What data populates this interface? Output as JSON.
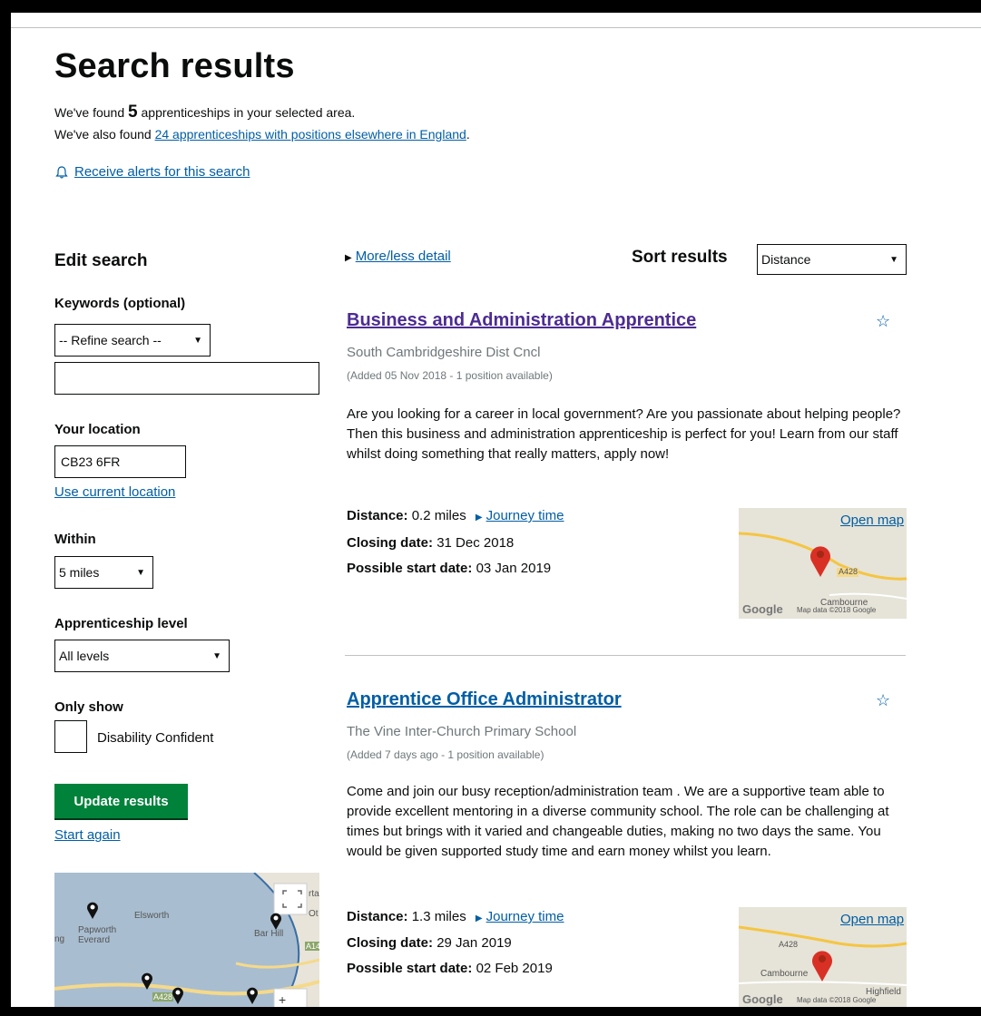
{
  "page": {
    "title": "Search results",
    "summary_prefix": "We've found",
    "summary_count": "5",
    "summary_suffix": "apprenticeships in your selected area.",
    "also_prefix": "We've also found",
    "also_link": "24 apprenticeships with positions elsewhere in England",
    "also_suffix": ".",
    "alerts_link": "Receive alerts for this search"
  },
  "sidebar": {
    "heading": "Edit search",
    "keywords_label": "Keywords (optional)",
    "refine_select": "-- Refine search --",
    "keywords_value": "",
    "location_label": "Your location",
    "location_value": "CB23 6FR",
    "use_current_location": "Use current location",
    "within_label": "Within",
    "within_value": "5 miles",
    "level_label": "Apprenticeship level",
    "level_value": "All levels",
    "only_show_label": "Only show",
    "disability_label": "Disability Confident",
    "update_button": "Update results",
    "start_again": "Start again",
    "map_labels": [
      "Elsworth",
      "Papworth Everard",
      "ng",
      "Bar Hill",
      "A14",
      "A428",
      "Ot",
      "rta"
    ]
  },
  "results_header": {
    "more_less": "More/less detail",
    "sort_label": "Sort results",
    "sort_value": "Distance"
  },
  "results": [
    {
      "title": "Business and Administration Apprentice",
      "employer": "South Cambridgeshire Dist Cncl",
      "added": "(Added 05 Nov 2018 - 1 position available)",
      "description": "Are you looking for a career in local government? Are you passionate about helping people? Then this business and administration apprenticeship is perfect for you! Learn from our staff whilst doing something that really matters, apply now!",
      "distance_label": "Distance:",
      "distance_value": "0.2 miles",
      "journey": "Journey time",
      "closing_label": "Closing date:",
      "closing_value": "31 Dec 2018",
      "start_label": "Possible start date:",
      "start_value": "03 Jan 2019",
      "open_map": "Open map",
      "map_text": [
        "A428",
        "Cambourne",
        "Google",
        "Map data ©2018 Google"
      ]
    },
    {
      "title": "Apprentice Office Administrator",
      "employer": "The Vine Inter-Church Primary School",
      "added": "(Added 7 days ago - 1 position available)",
      "description": "Come and join our busy reception/administration team . We are a supportive team able to provide excellent mentoring in a diverse community school. The role can be challenging at times but brings with it varied and changeable duties, making no two days the same. You would be given supported study time and earn money whilst you learn.",
      "distance_label": "Distance:",
      "distance_value": "1.3 miles",
      "journey": "Journey time",
      "closing_label": "Closing date:",
      "closing_value": "29 Jan 2019",
      "start_label": "Possible start date:",
      "start_value": "02 Feb 2019",
      "open_map": "Open map",
      "map_text": [
        "A428",
        "Cambourne",
        "Highfield",
        "Google",
        "Map data ©2018 Google"
      ]
    }
  ],
  "colors": {
    "link": "#005ea5",
    "visited": "#4c2c92",
    "button": "#00823b",
    "pin": "#d93025",
    "map_area": "#a8bdd0"
  }
}
